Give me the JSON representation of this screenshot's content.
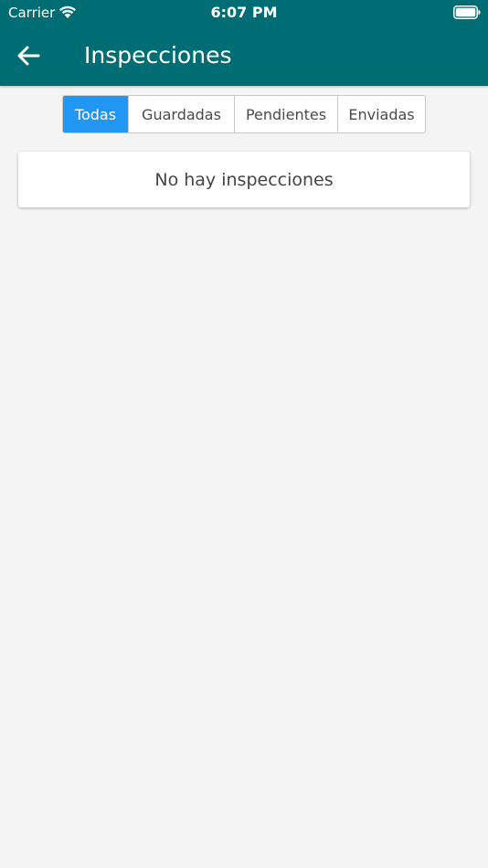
{
  "status_bar": {
    "carrier": "Carrier",
    "time": "6:07 PM",
    "icons": [
      "wifi-icon",
      "battery-icon"
    ]
  },
  "header": {
    "title": "Inspecciones",
    "back_icon": "arrow-left-icon",
    "background_color": "#006d75"
  },
  "tabs": [
    {
      "label": "Todas",
      "active": true
    },
    {
      "label": "Guardadas",
      "active": false
    },
    {
      "label": "Pendientes",
      "active": false
    },
    {
      "label": "Enviadas",
      "active": false
    }
  ],
  "tabs_active_color": "#2196f3",
  "list": {
    "empty_message": "No hay inspecciones"
  }
}
